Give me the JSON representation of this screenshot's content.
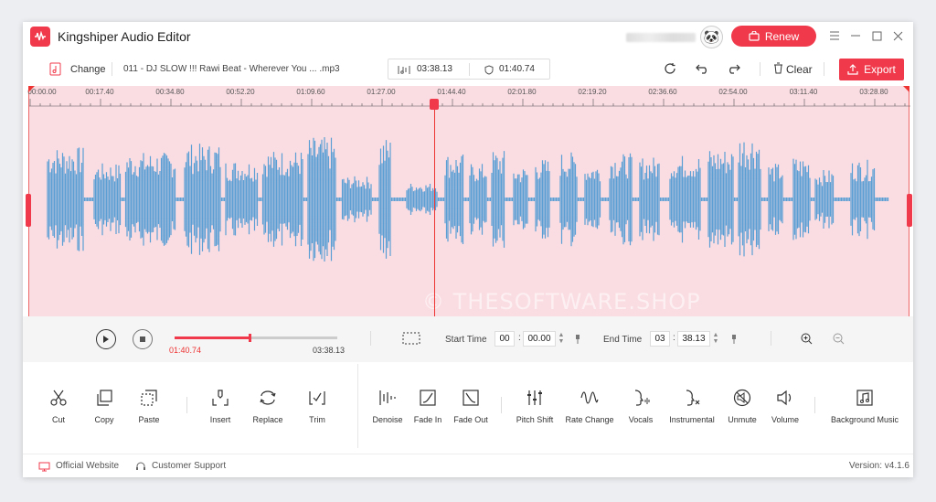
{
  "app": {
    "title": "Kingshiper Audio Editor",
    "renew_label": "Renew"
  },
  "toolbar": {
    "change_label": "Change",
    "file_name": "011 - DJ SLOW !!! Rawi Beat - Wherever You ... .mp3",
    "total_duration": "03:38.13",
    "selection_duration": "01:40.74",
    "clear_label": "Clear",
    "export_label": "Export"
  },
  "timeline": {
    "labels": [
      "00:00.00",
      "00:17.40",
      "00:34.80",
      "00:52.20",
      "01:09.60",
      "01:27.00",
      "01:44.40",
      "02:01.80",
      "02:19.20",
      "02:36.60",
      "02:54.00",
      "03:11.40",
      "03:28.80"
    ]
  },
  "watermark": "© THESOFTWARE.SHOP",
  "playback": {
    "current_time": "01:40.74",
    "total_time": "03:38.13",
    "progress": 0.4617,
    "start_label": "Start Time",
    "start_min": "00",
    "start_sec": "00.00",
    "end_label": "End Time",
    "end_min": "03",
    "end_sec": "38.13"
  },
  "tools": [
    {
      "label": "Cut",
      "icon": "scissors-icon"
    },
    {
      "label": "Copy",
      "icon": "copy-icon"
    },
    {
      "label": "Paste",
      "icon": "paste-icon"
    },
    {
      "label": "Insert",
      "icon": "insert-icon"
    },
    {
      "label": "Replace",
      "icon": "replace-icon"
    },
    {
      "label": "Trim",
      "icon": "trim-icon"
    },
    {
      "label": "Denoise",
      "icon": "denoise-icon"
    },
    {
      "label": "Fade In",
      "icon": "fade-in-icon"
    },
    {
      "label": "Fade Out",
      "icon": "fade-out-icon"
    },
    {
      "label": "Pitch Shift",
      "icon": "pitch-shift-icon"
    },
    {
      "label": "Rate Change",
      "icon": "rate-change-icon"
    },
    {
      "label": "Vocals",
      "icon": "vocals-icon"
    },
    {
      "label": "Instrumental",
      "icon": "instrumental-icon"
    },
    {
      "label": "Unmute",
      "icon": "unmute-icon"
    },
    {
      "label": "Volume",
      "icon": "volume-icon"
    },
    {
      "label": "Background Music",
      "icon": "background-music-icon"
    }
  ],
  "footer": {
    "website_label": "Official Website",
    "support_label": "Customer Support",
    "version": "Version: v4.1.6"
  },
  "colors": {
    "accent": "#f03a4b",
    "waveform": "#5b9fd4",
    "selection_bg": "#fadde3"
  }
}
